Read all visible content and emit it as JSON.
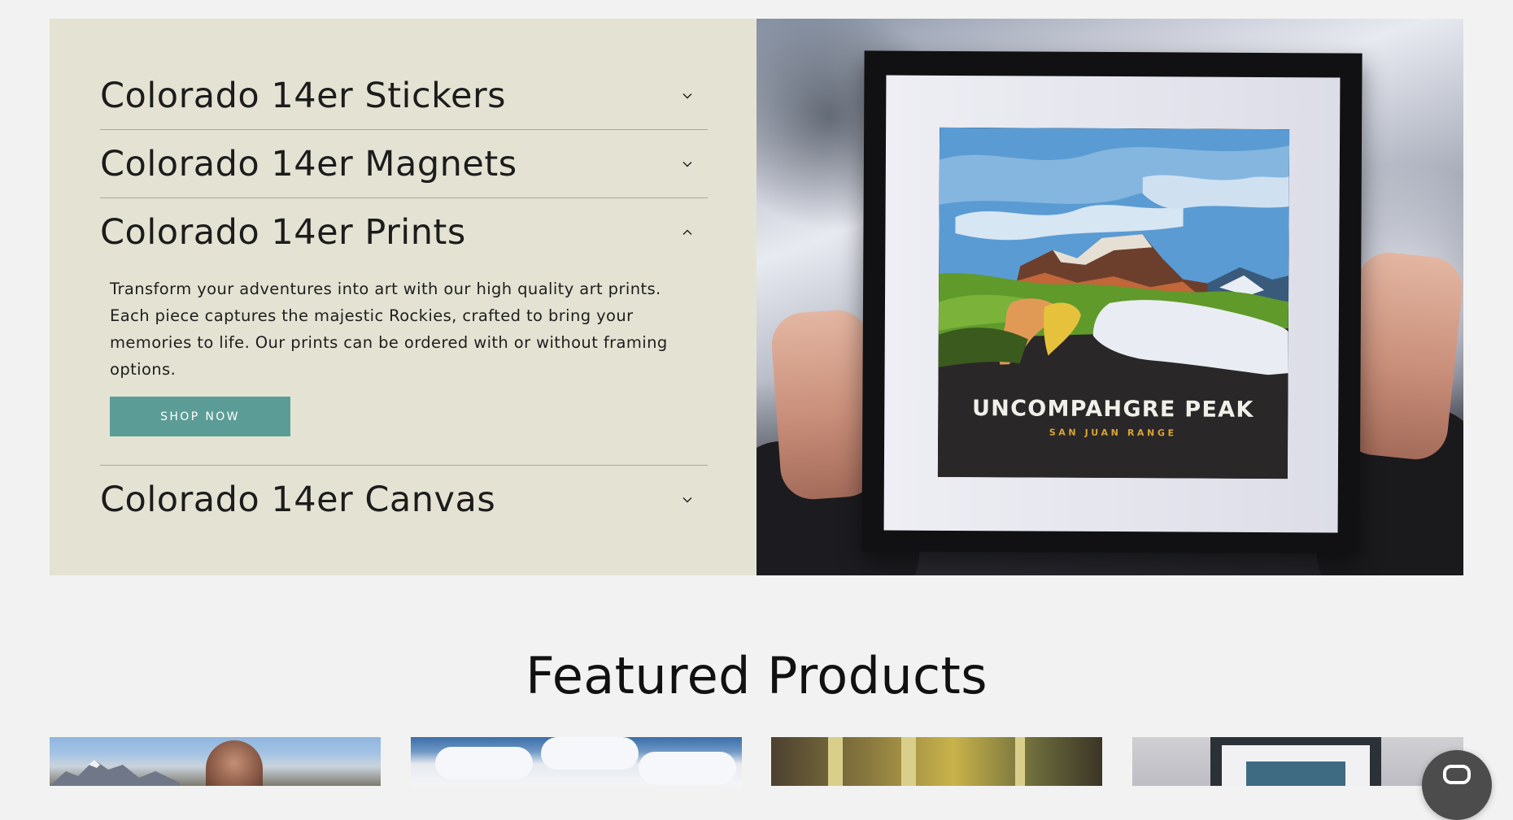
{
  "collections": {
    "items": [
      {
        "title": "Colorado 14er Stickers",
        "expanded": false,
        "chevron_icon": "chevron-down-icon"
      },
      {
        "title": "Colorado 14er Magnets",
        "expanded": false,
        "chevron_icon": "chevron-down-icon"
      },
      {
        "title": "Colorado 14er Prints",
        "expanded": true,
        "chevron_icon": "chevron-up-icon",
        "description": "Transform your adventures into art with our high quality art prints. Each piece captures the majestic Rockies, crafted to bring your memories to life. Our prints can be ordered with or without framing options.",
        "button_label": "SHOP NOW"
      },
      {
        "title": "Colorado 14er Canvas",
        "expanded": false,
        "chevron_icon": "chevron-down-icon"
      }
    ]
  },
  "hero_image": {
    "print_title": "UNCOMPAHGRE PEAK",
    "print_subtitle": "SAN JUAN RANGE"
  },
  "featured": {
    "title": "Featured Products"
  },
  "colors": {
    "panel_bg": "#e4e3d3",
    "button_bg": "#5c9c97",
    "page_bg": "#f2f2f2"
  },
  "chat": {
    "icon": "chat-icon"
  }
}
